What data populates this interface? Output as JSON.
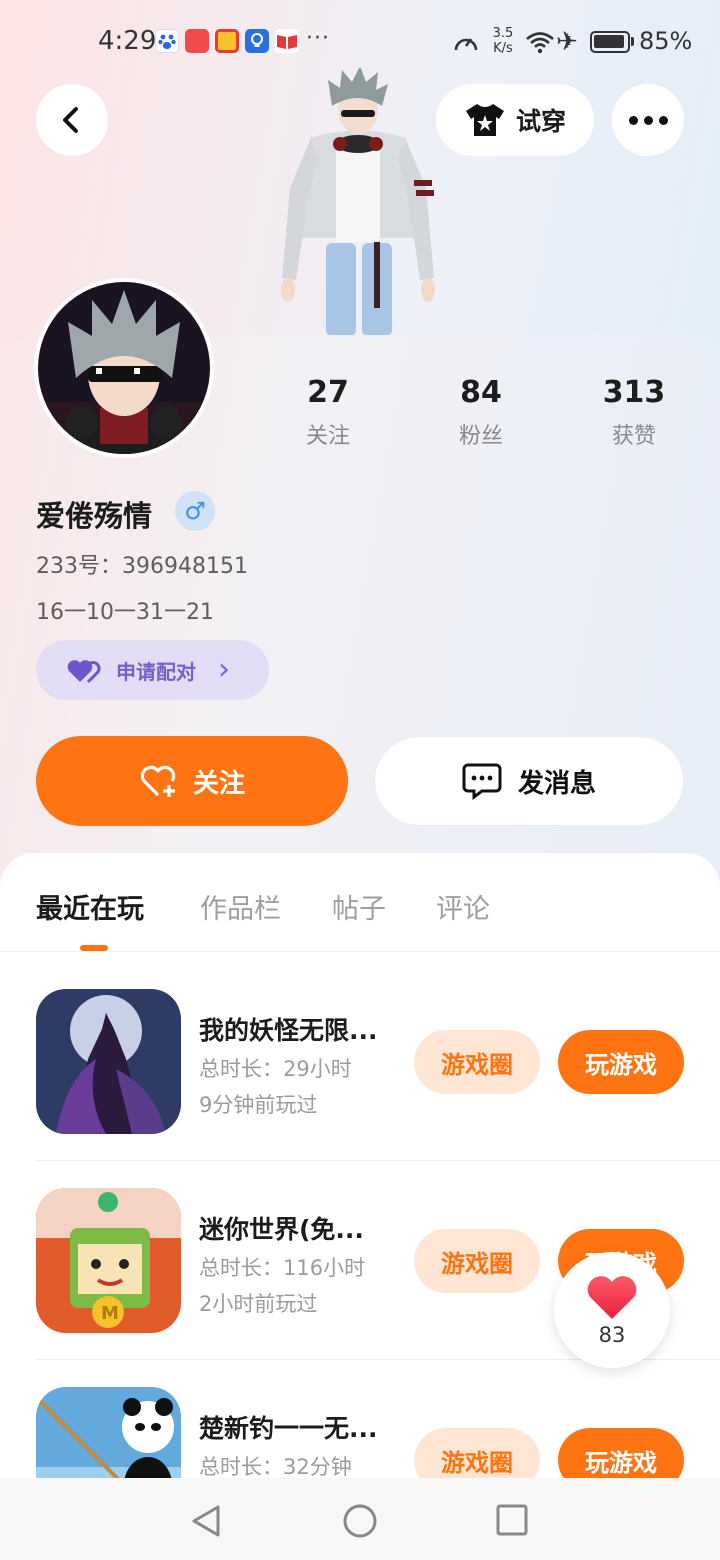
{
  "status_bar": {
    "time": "4:29",
    "more": "···",
    "net_speed": "3.5 K/s",
    "battery": "85%",
    "app_icons": [
      "baidu-app-icon",
      "huawei-app-icon",
      "video-app-icon",
      "bulb-app-icon",
      "book-app-icon"
    ]
  },
  "header": {
    "try_on_label": "试穿"
  },
  "profile": {
    "stats": [
      {
        "value": "27",
        "label": "关注"
      },
      {
        "value": "84",
        "label": "粉丝"
      },
      {
        "value": "313",
        "label": "获赞"
      }
    ],
    "username": "爱倦殇情",
    "gender_symbol": "♂",
    "id_text": "233号：396948151",
    "birthday": "16一10一31一21",
    "pair_label": "申请配对",
    "pair_chevron": "›",
    "follow_label": "关注",
    "message_label": "发消息"
  },
  "tabs": [
    "最近在玩",
    "作品栏",
    "帖子",
    "评论"
  ],
  "games": [
    {
      "title": "我的妖怪无限...",
      "playtime": "总时长：29小时",
      "last_played": "9分钟前玩过",
      "circle_label": "游戏圈",
      "play_label": "玩游戏"
    },
    {
      "title": "迷你世界(免...",
      "playtime": "总时长：116小时",
      "last_played": "2小时前玩过",
      "circle_label": "游戏圈",
      "play_label": "玩游戏"
    },
    {
      "title": "楚新钓一一无...",
      "playtime": "总时长：32分钟",
      "last_played": "",
      "circle_label": "游戏圈",
      "play_label": "玩游戏"
    }
  ],
  "like_float": {
    "count": "83"
  },
  "colors": {
    "accent": "#ff7412",
    "accent_light": "#ffe6d4",
    "pair_bg": "#e3dcf5",
    "pair_text": "#7661c8",
    "gender_blue": "#3d8ff0"
  }
}
